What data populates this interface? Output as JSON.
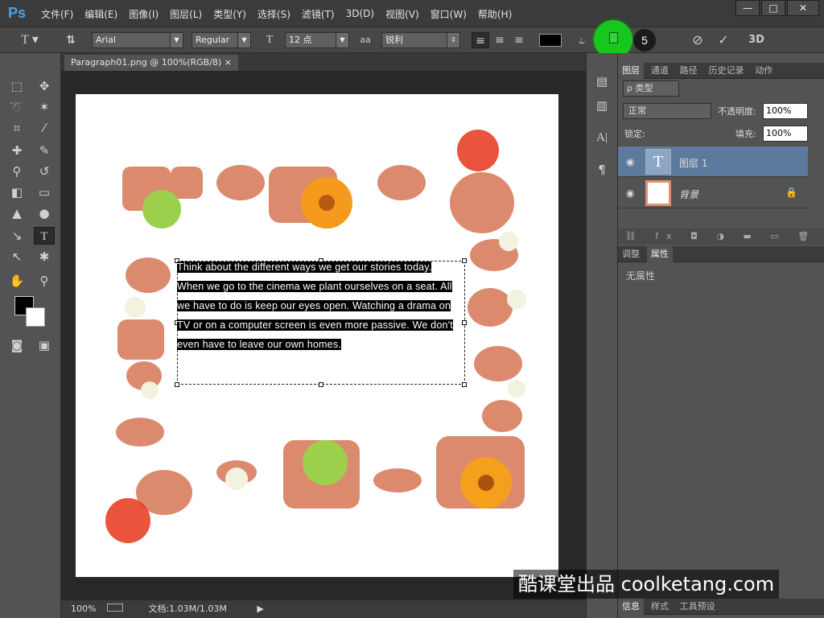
{
  "app": {
    "logo": "Ps"
  },
  "menu": [
    "文件(F)",
    "编辑(E)",
    "图像(I)",
    "图层(L)",
    "类型(Y)",
    "选择(S)",
    "滤镜(T)",
    "3D(D)",
    "视图(V)",
    "窗口(W)",
    "帮助(H)"
  ],
  "window_controls": {
    "minimize": "—",
    "restore": "□",
    "close": "✕"
  },
  "options": {
    "font_family": "Arial",
    "font_style": "Regular",
    "font_size": "12 点",
    "aa_label": "aa",
    "antialias": "锐利",
    "text_color": "#000000",
    "threed_label": "3D"
  },
  "badge": "5",
  "doc_tab": {
    "title": "Paragraph01.png @ 100%(RGB/8)",
    "close": "×"
  },
  "paragraph_lines": [
    "Think about the different ways we get our stories today.",
    "When we go to the cinema we plant ourselves on a seat. All",
    "we have to do is keep our eyes open. Watching a drama on",
    "TV or on a computer screen is even more passive. We don't",
    "even have to leave our own homes."
  ],
  "status": {
    "zoom": "100%",
    "doc_info": "文档:1.03M/1.03M"
  },
  "layers_panel": {
    "tabs": [
      "图层",
      "通道",
      "路径",
      "历史记录",
      "动作"
    ],
    "filter": "ρ 类型",
    "blend_mode": "正常",
    "opacity_label": "不透明度:",
    "opacity": "100%",
    "lock_label": "锁定:",
    "fill_label": "填充:",
    "fill": "100%",
    "layers": [
      {
        "name": "图层 1",
        "selected": true
      },
      {
        "name": "背景",
        "selected": false
      }
    ]
  },
  "props_panel": {
    "tabs": [
      "调整",
      "属性"
    ],
    "content": "无属性"
  },
  "bottom_tabs": [
    "信息",
    "样式",
    "工具预设"
  ],
  "watermark": "酷课堂出品 coolketang.com",
  "colors": {
    "accent": "#17c61f",
    "selected_layer": "#5b7a9e",
    "panel": "#535353"
  }
}
